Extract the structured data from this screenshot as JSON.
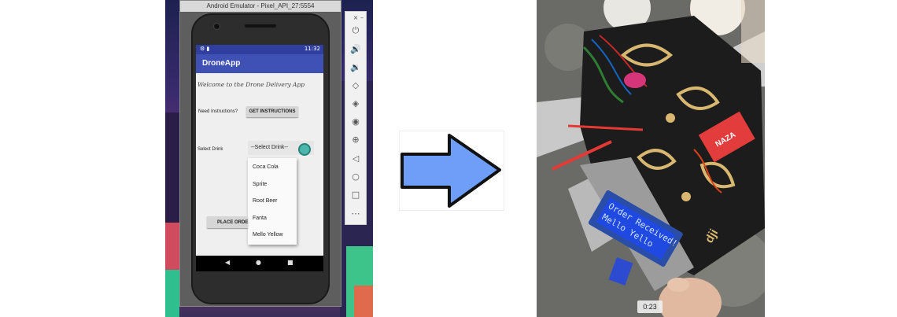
{
  "emulator": {
    "window_title": "Android Emulator - Pixel_API_27:5554",
    "window_controls": [
      "×",
      "–"
    ]
  },
  "phone": {
    "status_time": "11:32",
    "app_title": "DroneApp",
    "welcome_text": "Welcome to the Drone Delivery App",
    "instructions_label": "Need Instructions?",
    "instructions_button": "GET INSTRUCTIONS",
    "drink_label": "Select Drink",
    "spinner_value": "--Select Drink--",
    "drink_options": [
      "Coca Cola",
      "Sprite",
      "Root Beer",
      "Fanta",
      "Mello Yellow"
    ],
    "place_order_button": "PLACE ORDER",
    "nav_icons": [
      "back-icon",
      "home-icon",
      "recents-icon"
    ]
  },
  "toolbar_icons": [
    "power-icon",
    "volume-up-icon",
    "volume-down-icon",
    "rotate-left-icon",
    "rotate-right-icon",
    "camera-icon",
    "zoom-icon",
    "back-icon",
    "home-icon",
    "overview-icon",
    "more-icon"
  ],
  "arrow": {
    "color": "#6f9ef8",
    "outline": "#111111"
  },
  "photo": {
    "lcd_line1": "Order Received!",
    "lcd_line2": "Mello Yello",
    "frame_brand": "dji",
    "controller_label": "NAZA",
    "timestamp": "0:23"
  }
}
